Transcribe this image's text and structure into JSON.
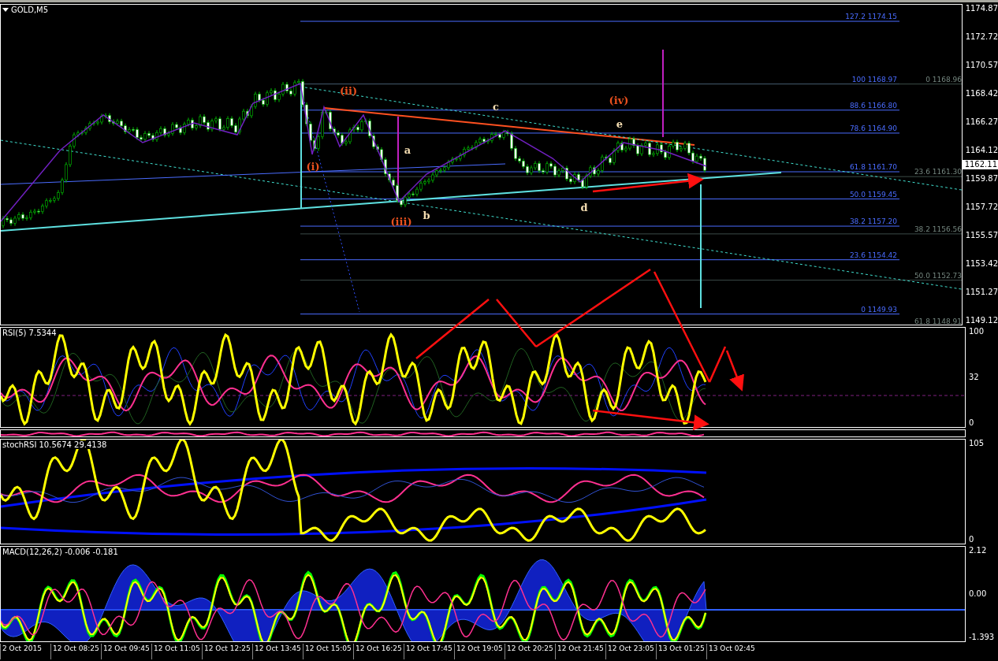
{
  "chart": {
    "title": "GOLD,M5"
  },
  "price_axis": [
    "1174.87",
    "1172.72",
    "1170.57",
    "1168.42",
    "1166.27",
    "1164.12",
    "1159.87",
    "1157.72",
    "1155.57",
    "1153.42",
    "1151.27",
    "1149.12"
  ],
  "current_price": "1162.11",
  "fib_levels": [
    {
      "label": "127.2 1174.15",
      "kind": "extension"
    },
    {
      "label": "100 1168.97",
      "kind": "extension"
    },
    {
      "label": "88.6 1166.80",
      "kind": "extension"
    },
    {
      "label": "78.6 1164.90",
      "kind": "extension"
    },
    {
      "label": "61.8 1161.70",
      "kind": "extension"
    },
    {
      "label": "50.0 1159.45",
      "kind": "extension"
    },
    {
      "label": "38.2 1157.20",
      "kind": "extension"
    },
    {
      "label": "23.6 1154.42",
      "kind": "extension"
    },
    {
      "label": "0 1149.93",
      "kind": "extension"
    },
    {
      "label": "0 1168.96",
      "kind": "retracement"
    },
    {
      "label": "23.6 1161.30",
      "kind": "retracement"
    },
    {
      "label": "38.2 1156.56",
      "kind": "retracement"
    },
    {
      "label": "50.0 1152.73",
      "kind": "retracement"
    },
    {
      "label": "61.8 1148.91",
      "kind": "retracement"
    }
  ],
  "waves": [
    {
      "label": "(i)",
      "kind": "impulse"
    },
    {
      "label": "(ii)",
      "kind": "impulse"
    },
    {
      "label": "(iii)",
      "kind": "impulse"
    },
    {
      "label": "(iv)",
      "kind": "impulse"
    },
    {
      "label": "a",
      "kind": "corrective"
    },
    {
      "label": "b",
      "kind": "corrective"
    },
    {
      "label": "c",
      "kind": "corrective"
    },
    {
      "label": "d",
      "kind": "corrective"
    },
    {
      "label": "e",
      "kind": "corrective"
    }
  ],
  "rsi": {
    "label": "RSI(5) 7.5344",
    "axis": [
      "100",
      "32",
      "0"
    ]
  },
  "stoch_rsi": {
    "label": "stochRSI 10.5674 29.4138",
    "axis": [
      "105",
      "0"
    ]
  },
  "macd": {
    "label": "MACD(12,26,2) -0.006 -0.181",
    "axis": [
      "2.12",
      "0.00",
      "-1.393"
    ]
  },
  "time_axis": [
    "2 Oct 2015",
    "12 Oct 08:25",
    "12 Oct 09:45",
    "12 Oct 11:05",
    "12 Oct 12:25",
    "12 Oct 13:45",
    "12 Oct 15:05",
    "12 Oct 16:25",
    "12 Oct 17:45",
    "12 Oct 19:05",
    "12 Oct 20:25",
    "12 Oct 21:45",
    "12 Oct 23:05",
    "13 Oct 01:25",
    "13 Oct 02:45"
  ]
}
